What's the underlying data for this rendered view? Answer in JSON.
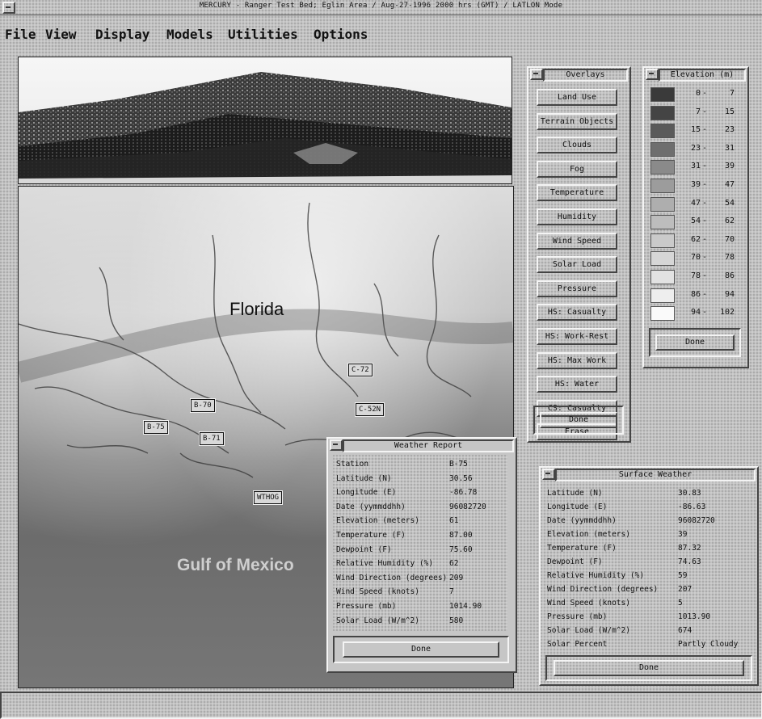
{
  "window": {
    "title": "MERCURY - Ranger Test Bed; Eglin Area / Aug-27-1996 2000 hrs (GMT) / LATLON Mode"
  },
  "menu": [
    "File",
    "View",
    "Display",
    "Models",
    "Utilities",
    "Options"
  ],
  "map": {
    "region_label": "Florida",
    "water_label": "Gulf of Mexico",
    "stations": [
      "C-72",
      "B-70",
      "C-52N",
      "B-75",
      "B-71",
      "WTHOG"
    ]
  },
  "overlays": {
    "title": "Overlays",
    "buttons": [
      "Land Use",
      "Terrain Objects",
      "Clouds",
      "Fog",
      "Temperature",
      "Humidity",
      "Wind Speed",
      "Solar Load",
      "Pressure",
      "HS: Casualty",
      "HS: Work-Rest",
      "HS: Max Work",
      "HS: Water",
      "CS: Casualty",
      "Erase"
    ],
    "done": "Done"
  },
  "elevation": {
    "title": "Elevation (m)",
    "rows": [
      {
        "lo": "0",
        "hi": "7",
        "color": "#3a3a3a"
      },
      {
        "lo": "7",
        "hi": "15",
        "color": "#444444"
      },
      {
        "lo": "15",
        "hi": "23",
        "color": "#5a5a5a"
      },
      {
        "lo": "23",
        "hi": "31",
        "color": "#6e6e6e"
      },
      {
        "lo": "31",
        "hi": "39",
        "color": "#8a8a8a"
      },
      {
        "lo": "39",
        "hi": "47",
        "color": "#9c9c9c"
      },
      {
        "lo": "47",
        "hi": "54",
        "color": "#aeaeae"
      },
      {
        "lo": "54",
        "hi": "62",
        "color": "#bdbdbd"
      },
      {
        "lo": "62",
        "hi": "70",
        "color": "#cacaca"
      },
      {
        "lo": "70",
        "hi": "78",
        "color": "#d6d6d6"
      },
      {
        "lo": "78",
        "hi": "86",
        "color": "#e2e2e2"
      },
      {
        "lo": "86",
        "hi": "94",
        "color": "#eeeeee"
      },
      {
        "lo": "94",
        "hi": "102",
        "color": "#fafafa"
      }
    ],
    "done": "Done"
  },
  "weather_report": {
    "title": "Weather Report",
    "rows": [
      {
        "k": "Station",
        "v": "B-75"
      },
      {
        "k": "Latitude (N)",
        "v": "30.56"
      },
      {
        "k": "Longitude (E)",
        "v": "-86.78"
      },
      {
        "k": "Date (yymmddhh)",
        "v": "96082720"
      },
      {
        "k": "Elevation (meters)",
        "v": "61"
      },
      {
        "k": "Temperature (F)",
        "v": "87.00"
      },
      {
        "k": "Dewpoint (F)",
        "v": "75.60"
      },
      {
        "k": "Relative Humidity (%)",
        "v": "62"
      },
      {
        "k": "Wind Direction (degrees)",
        "v": "209"
      },
      {
        "k": "Wind Speed (knots)",
        "v": "7"
      },
      {
        "k": "Pressure (mb)",
        "v": "1014.90"
      },
      {
        "k": "Solar Load (W/m^2)",
        "v": "580"
      }
    ],
    "done": "Done"
  },
  "surface_weather": {
    "title": "Surface Weather",
    "rows": [
      {
        "k": "Latitude (N)",
        "v": "30.83"
      },
      {
        "k": "Longitude (E)",
        "v": "-86.63"
      },
      {
        "k": "Date (yymmddhh)",
        "v": "96082720"
      },
      {
        "k": "Elevation (meters)",
        "v": "39"
      },
      {
        "k": "Temperature (F)",
        "v": "87.32"
      },
      {
        "k": "Dewpoint (F)",
        "v": "74.63"
      },
      {
        "k": "Relative Humidity (%)",
        "v": "59"
      },
      {
        "k": "Wind Direction (degrees)",
        "v": "207"
      },
      {
        "k": "Wind Speed (knots)",
        "v": "5"
      },
      {
        "k": "Pressure (mb)",
        "v": "1013.90"
      },
      {
        "k": "Solar Load (W/m^2)",
        "v": "674"
      },
      {
        "k": "Solar Percent",
        "v": "Partly Cloudy"
      }
    ],
    "done": "Done"
  }
}
